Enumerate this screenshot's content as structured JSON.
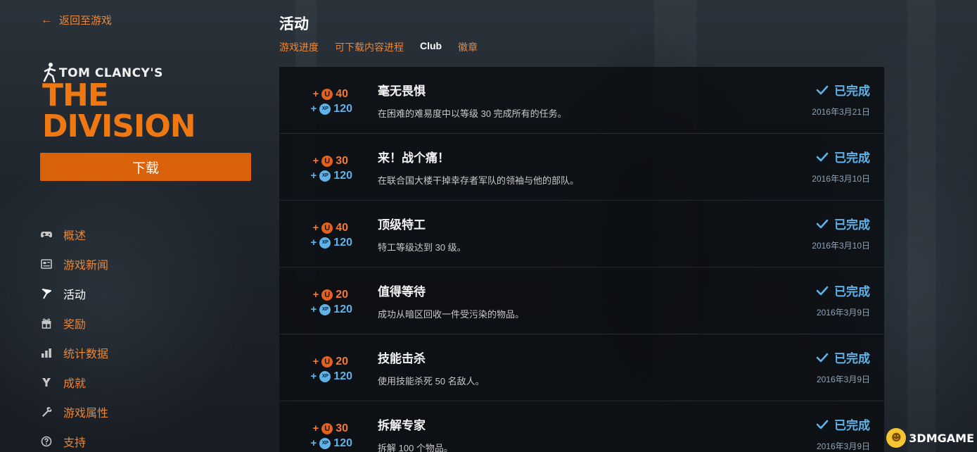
{
  "sidebar": {
    "back_label": "返回至游戏",
    "logo": {
      "line1": "TOM CLANCY'S",
      "line2": "THE DIVISION"
    },
    "download_label": "下载",
    "nav": [
      {
        "label": "概述",
        "icon": "gamepad-icon",
        "active": false
      },
      {
        "label": "游戏新闻",
        "icon": "news-icon",
        "active": false
      },
      {
        "label": "活动",
        "icon": "flag-icon",
        "active": true
      },
      {
        "label": "奖励",
        "icon": "gift-icon",
        "active": false
      },
      {
        "label": "统计数据",
        "icon": "bar-chart-icon",
        "active": false
      },
      {
        "label": "成就",
        "icon": "trophy-icon",
        "active": false
      },
      {
        "label": "游戏属性",
        "icon": "wrench-icon",
        "active": false
      },
      {
        "label": "支持",
        "icon": "help-icon",
        "active": false
      }
    ]
  },
  "main": {
    "title": "活动",
    "tabs": [
      {
        "label": "游戏进度",
        "active": false
      },
      {
        "label": "可下载内容进程",
        "active": false
      },
      {
        "label": "Club",
        "active": true
      },
      {
        "label": "徽章",
        "active": false
      }
    ],
    "xp_badge_text": "XP",
    "u_badge_text": "U",
    "activities": [
      {
        "title": "毫无畏惧",
        "desc": "在困难的难易度中以等级 30 完成所有的任务。",
        "units": "40",
        "xp": "120",
        "status": "已完成",
        "date": "2016年3月21日"
      },
      {
        "title": "来！战个痛！",
        "desc": "在联合国大楼干掉幸存者军队的领袖与他的部队。",
        "units": "30",
        "xp": "120",
        "status": "已完成",
        "date": "2016年3月10日"
      },
      {
        "title": "顶级特工",
        "desc": "特工等级达到 30 级。",
        "units": "40",
        "xp": "120",
        "status": "已完成",
        "date": "2016年3月10日"
      },
      {
        "title": "值得等待",
        "desc": "成功从暗区回收一件受污染的物品。",
        "units": "20",
        "xp": "120",
        "status": "已完成",
        "date": "2016年3月9日"
      },
      {
        "title": "技能击杀",
        "desc": "使用技能杀死 50 名敌人。",
        "units": "20",
        "xp": "120",
        "status": "已完成",
        "date": "2016年3月9日"
      },
      {
        "title": "拆解专家",
        "desc": "拆解 100 个物品。",
        "units": "30",
        "xp": "120",
        "status": "已完成",
        "date": "2016年3月9日"
      }
    ]
  },
  "watermark": {
    "text": "3DMGAME"
  },
  "colors": {
    "accent_orange": "#e8873a",
    "button_orange": "#d9620b",
    "xp_blue": "#5fb3e8",
    "units_orange": "#f07a3a"
  }
}
